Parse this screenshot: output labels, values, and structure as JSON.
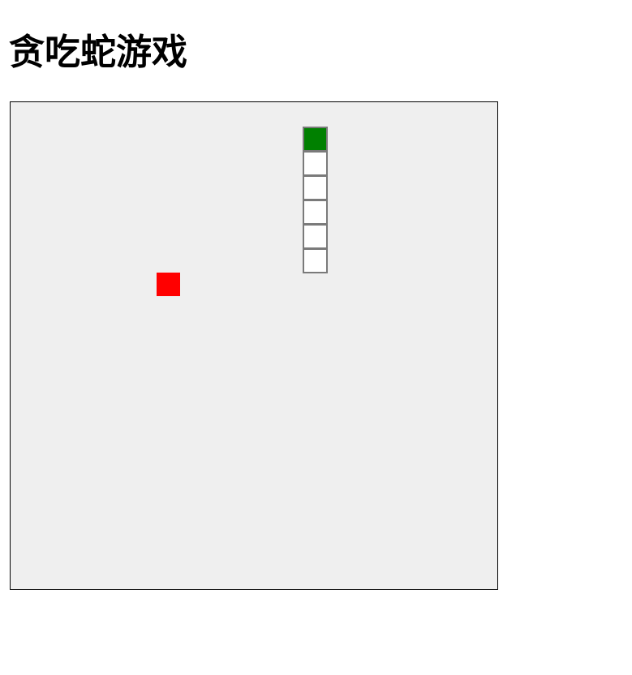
{
  "page": {
    "title": "贪吃蛇游戏"
  },
  "game": {
    "grid": {
      "cols": 20,
      "rows": 20
    },
    "snake": {
      "head_color": "#008000",
      "body_color": "#ffffff",
      "segments": [
        {
          "col": 12,
          "row": 1
        },
        {
          "col": 12,
          "row": 2
        },
        {
          "col": 12,
          "row": 3
        },
        {
          "col": 12,
          "row": 4
        },
        {
          "col": 12,
          "row": 5
        },
        {
          "col": 12,
          "row": 6
        }
      ]
    },
    "food": {
      "color": "#ff0000",
      "col": 6,
      "row": 7
    }
  }
}
